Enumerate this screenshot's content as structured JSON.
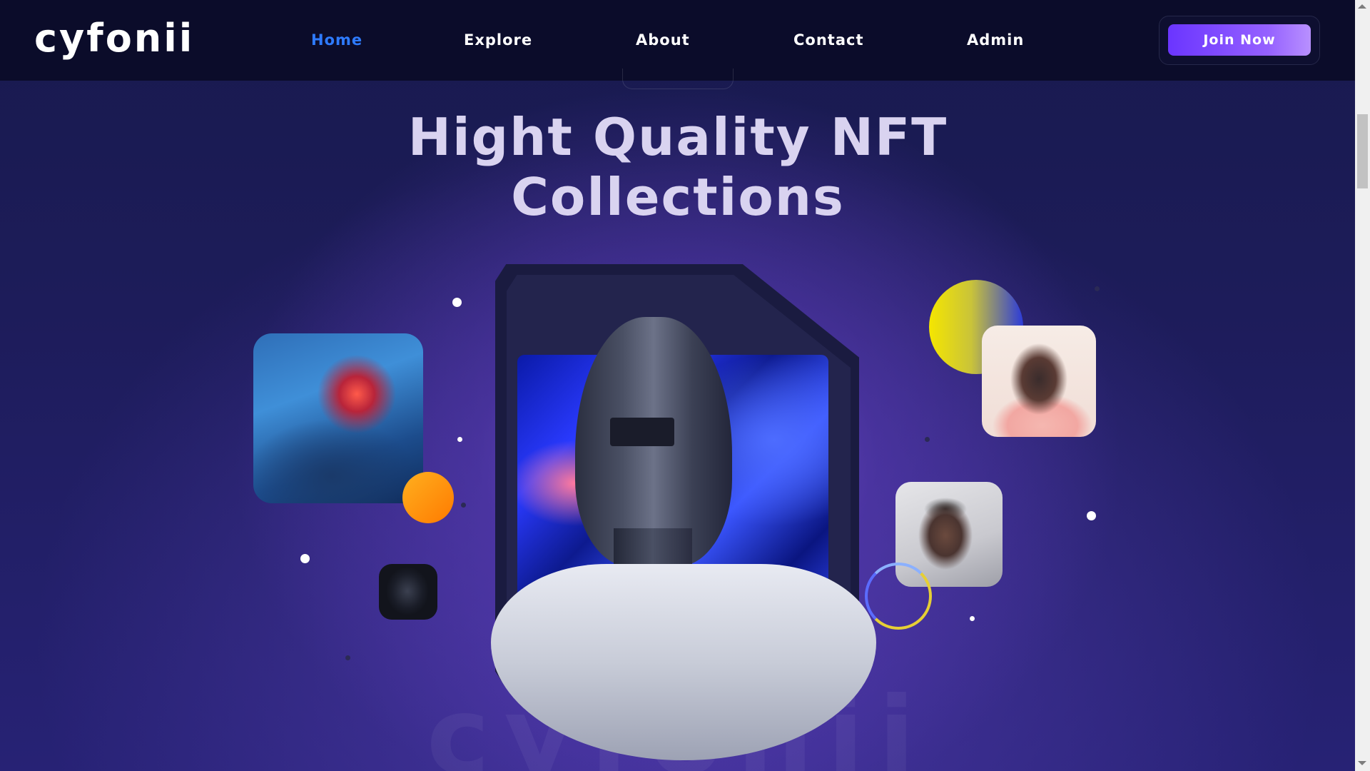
{
  "brand": {
    "logo_text": "cyfonii"
  },
  "nav": {
    "items": [
      {
        "label": "Home",
        "active": true
      },
      {
        "label": "Explore",
        "active": false
      },
      {
        "label": "About",
        "active": false
      },
      {
        "label": "Contact",
        "active": false
      },
      {
        "label": "Admin",
        "active": false
      }
    ],
    "cta_label": "Join Now"
  },
  "hero": {
    "title_line1": "Hight Quality NFT",
    "title_line2": "Collections",
    "watermark_text": "cyfonii"
  },
  "colors": {
    "nav_bg": "#0b0c2a",
    "active_link": "#2e7bff",
    "cta_gradient_start": "#6b35ff",
    "cta_gradient_end": "#b890ff",
    "page_bg": "#1d1c5a"
  },
  "icons": [
    "chevron-up-icon",
    "chevron-down-icon"
  ]
}
